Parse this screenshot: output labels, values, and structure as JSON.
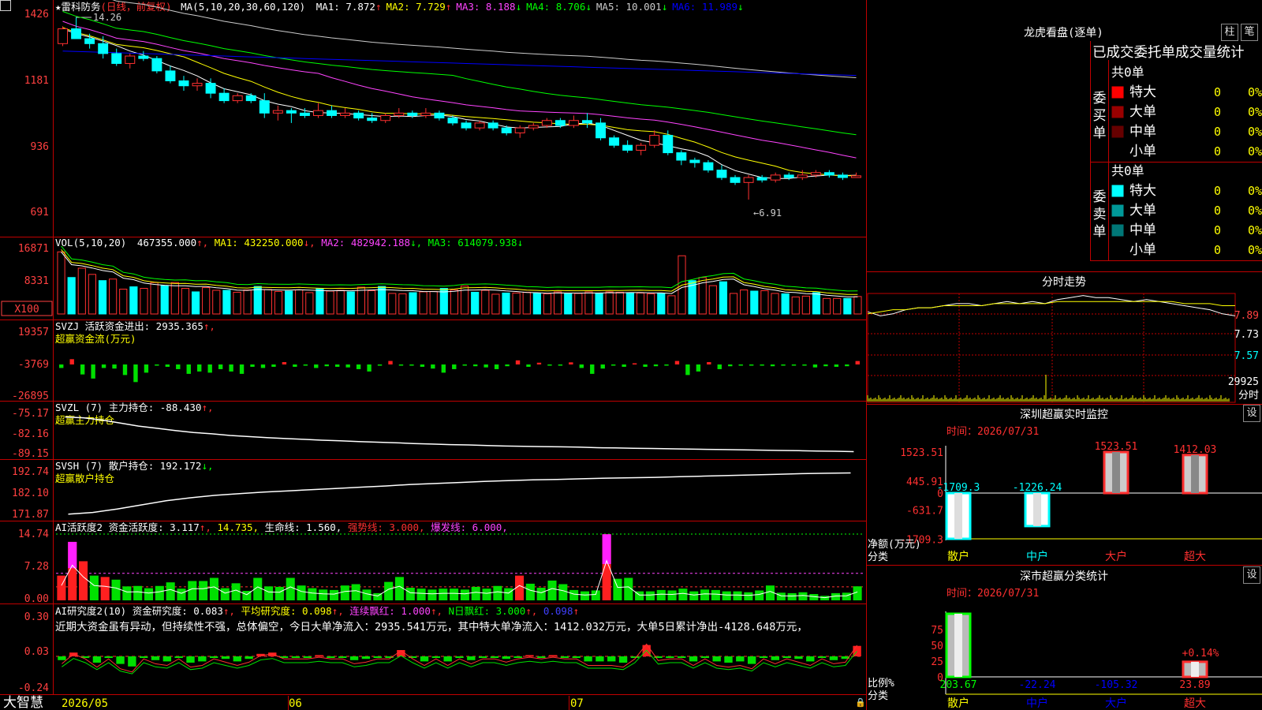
{
  "stock": {
    "name": "★雷科防务",
    "mode": "(日线，前复权)",
    "ma_caption": "MA(5,10,20,30,60,120)",
    "ma_values": [
      {
        "label": "MA1: 7.872",
        "arrow": "↑",
        "color": "#ffffff"
      },
      {
        "label": "MA2: 7.729",
        "arrow": "↑",
        "color": "#ffff00"
      },
      {
        "label": "MA3: 8.188",
        "arrow": "↓",
        "color": "#ff44ff"
      },
      {
        "label": "MA4: 8.706",
        "arrow": "↓",
        "color": "#00ff00"
      },
      {
        "label": "MA5: 10.001",
        "arrow": "↓",
        "color": "#cccccc"
      },
      {
        "label": "MA6: 11.989",
        "arrow": "↓",
        "color": "#0000ff"
      }
    ],
    "high_mark": "14.26",
    "low_mark": "←6.91"
  },
  "vol": {
    "caption": "VOL(5,10,20)",
    "value": "467355.000",
    "ma1": "MA1: 432250.000",
    "ma2": "MA2: 482942.188",
    "ma3": "MA3: 614079.938",
    "unit_label": "X100"
  },
  "svzj": {
    "caption": "SVZJ 活跃资金进出: 2935.365",
    "sub": "超赢资金流(万元)"
  },
  "svzl": {
    "caption": "SVZL (7) 主力持仓: -88.430",
    "sub": "超赢主力持仓"
  },
  "svsh": {
    "caption": "SVSH (7) 散户持仓: 192.172",
    "sub": "超赢散户持仓"
  },
  "ai_active": {
    "caption": "AI活跃度2 资金活跃度: 3.117",
    "v2": "14.735,",
    "v3": "生命线: 1.560,",
    "v4": "强势线: 3.000,",
    "v5": "爆发线: 6.000,"
  },
  "ai_research": {
    "caption": "AI研究度2(10) 资金研究度: 0.083",
    "v2": "平均研究度: 0.098",
    "v3": "连续飘红: 1.000",
    "v4": "N日飘红: 3.000",
    "v5": "0.098",
    "comment": "近期大资金虽有异动，但持续性不强，总体偏空，今日大单净流入：2935.541万元，其中特大单净流入：1412.032万元，大单5日累计净出-4128.648万元，"
  },
  "yaxis": {
    "price": [
      "1426",
      "1181",
      "936",
      "691"
    ],
    "vol": [
      "16871",
      "8331"
    ],
    "svzj": [
      "19357",
      "-3769",
      "-26895"
    ],
    "svzl": [
      "-75.17",
      "-82.16",
      "-89.15"
    ],
    "svsh": [
      "192.74",
      "182.10",
      "171.87"
    ],
    "ai_active": [
      "14.74",
      "7.28",
      "0.00"
    ],
    "ai_research": [
      "0.30",
      "0.03",
      "-0.24"
    ]
  },
  "xaxis": {
    "labels": [
      "2026/05",
      "06",
      "07"
    ],
    "brand": "大智慧"
  },
  "right_panel": {
    "longhu_title": "龙虎看盘(逐单)",
    "btn_zhu": "柱",
    "btn_bi": "笔",
    "stats_title": "已成交委托单成交量统计",
    "buy_label": "委买单",
    "sell_label": "委卖单",
    "buy_total": "共0单",
    "sell_total": "共0单",
    "buy_rows": [
      {
        "name": "特大",
        "count": "0",
        "pct": "0%",
        "color": "#ff0000"
      },
      {
        "name": "大单",
        "count": "0",
        "pct": "0%",
        "color": "#990000"
      },
      {
        "name": "中单",
        "count": "0",
        "pct": "0%",
        "color": "#660000"
      },
      {
        "name": "小单",
        "count": "0",
        "pct": "0%",
        "color": "#000000"
      }
    ],
    "sell_rows": [
      {
        "name": "特大",
        "count": "0",
        "pct": "0%",
        "color": "#00ffff"
      },
      {
        "name": "大单",
        "count": "0",
        "pct": "0%",
        "color": "#009999"
      },
      {
        "name": "中单",
        "count": "0",
        "pct": "0%",
        "color": "#007777"
      },
      {
        "name": "小单",
        "count": "0",
        "pct": "0%",
        "color": "#000000"
      }
    ],
    "intraday_title": "分时走势",
    "intraday_y": [
      "7.89",
      "7.73",
      "7.57"
    ],
    "intraday_vol": "29925",
    "intraday_vol_unit": "分时",
    "monitor_title": "深圳超赢实时监控",
    "monitor_set": "设",
    "monitor_time": "时间：2026/07/31",
    "monitor_y": [
      "1523.51",
      "445.91",
      "0",
      "-631.7",
      "-1709.3"
    ],
    "monitor_ylabel": "净额(万元)",
    "monitor_xlabel": "分类",
    "classify_title": "深市超赢分类统计",
    "classify_set": "设",
    "classify_time": "时间：2026/07/31",
    "classify_y": [
      "75",
      "50",
      "25",
      "0"
    ],
    "classify_ylabel": "比例%",
    "classify_xlabel": "分类",
    "classify_note": "+0.14%"
  },
  "chart_data": [
    {
      "type": "candlestick",
      "title": "雷科防务 日线",
      "note": "price axis labels shown x100",
      "ylim": [
        6.91,
        14.26
      ],
      "candles": [
        [
          13.2,
          13.9,
          13.1,
          13.8
        ],
        [
          13.8,
          14.26,
          13.5,
          13.4
        ],
        [
          13.4,
          13.6,
          13.0,
          13.2
        ],
        [
          13.2,
          13.5,
          12.6,
          12.8
        ],
        [
          12.8,
          13.0,
          12.3,
          12.4
        ],
        [
          12.4,
          12.8,
          12.2,
          12.7
        ],
        [
          12.7,
          12.9,
          12.5,
          12.6
        ],
        [
          12.6,
          12.7,
          12.0,
          12.1
        ],
        [
          12.1,
          12.3,
          11.6,
          11.7
        ],
        [
          11.7,
          11.9,
          11.3,
          11.5
        ],
        [
          11.5,
          11.8,
          11.3,
          11.6
        ],
        [
          11.6,
          11.8,
          11.0,
          11.2
        ],
        [
          11.2,
          11.4,
          10.8,
          10.9
        ],
        [
          10.9,
          11.2,
          10.8,
          11.1
        ],
        [
          11.1,
          11.2,
          10.8,
          10.9
        ],
        [
          10.9,
          11.2,
          10.2,
          10.4
        ],
        [
          10.4,
          10.7,
          10.1,
          10.5
        ],
        [
          10.5,
          10.6,
          10.0,
          10.4
        ],
        [
          10.4,
          10.6,
          10.2,
          10.3
        ],
        [
          10.3,
          10.8,
          10.2,
          10.5
        ],
        [
          10.5,
          10.7,
          10.2,
          10.3
        ],
        [
          10.3,
          10.6,
          10.2,
          10.4
        ],
        [
          10.4,
          10.5,
          10.1,
          10.2
        ],
        [
          10.2,
          10.4,
          10.0,
          10.1
        ],
        [
          10.1,
          10.4,
          10.0,
          10.3
        ],
        [
          10.3,
          10.6,
          10.2,
          10.4
        ],
        [
          10.4,
          10.5,
          10.2,
          10.3
        ],
        [
          10.3,
          10.6,
          10.2,
          10.4
        ],
        [
          10.4,
          10.5,
          10.1,
          10.2
        ],
        [
          10.2,
          10.3,
          9.9,
          10.0
        ],
        [
          10.0,
          10.1,
          9.7,
          9.8
        ],
        [
          9.8,
          10.1,
          9.7,
          10.0
        ],
        [
          10.0,
          10.1,
          9.7,
          9.8
        ],
        [
          9.8,
          9.9,
          9.5,
          9.6
        ],
        [
          9.6,
          9.9,
          9.4,
          9.8
        ],
        [
          9.8,
          10.0,
          9.7,
          9.9
        ],
        [
          9.9,
          10.2,
          9.8,
          10.1
        ],
        [
          10.1,
          10.2,
          9.8,
          9.9
        ],
        [
          9.9,
          10.3,
          9.8,
          10.1
        ],
        [
          10.1,
          10.4,
          9.8,
          10.0
        ],
        [
          10.0,
          10.2,
          9.3,
          9.4
        ],
        [
          9.4,
          9.5,
          9.0,
          9.1
        ],
        [
          9.1,
          9.3,
          8.8,
          8.9
        ],
        [
          8.9,
          9.2,
          8.7,
          9.1
        ],
        [
          9.1,
          9.7,
          9.0,
          9.5
        ],
        [
          9.5,
          9.7,
          8.7,
          8.8
        ],
        [
          8.8,
          8.9,
          8.3,
          8.5
        ],
        [
          8.5,
          8.6,
          8.2,
          8.4
        ],
        [
          8.4,
          8.5,
          8.0,
          8.1
        ],
        [
          8.1,
          8.3,
          7.7,
          7.8
        ],
        [
          7.8,
          7.9,
          7.5,
          7.6
        ],
        [
          7.6,
          7.9,
          6.91,
          7.8
        ],
        [
          7.8,
          7.9,
          7.6,
          7.7
        ],
        [
          7.7,
          8.0,
          7.6,
          7.9
        ],
        [
          7.9,
          8.0,
          7.7,
          7.8
        ],
        [
          7.8,
          8.1,
          7.7,
          7.9
        ],
        [
          7.9,
          8.1,
          7.8,
          8.0
        ],
        [
          8.0,
          8.1,
          7.8,
          7.9
        ],
        [
          7.9,
          8.0,
          7.7,
          7.8
        ],
        [
          7.8,
          8.0,
          7.8,
          7.87
        ]
      ],
      "ma_lines": [
        "MA5",
        "MA10",
        "MA20",
        "MA30",
        "MA60",
        "MA120"
      ]
    },
    {
      "type": "bar",
      "title": "VOL",
      "unit": "X100",
      "ylim": [
        0,
        16871
      ],
      "values": [
        16000,
        9400,
        11800,
        10200,
        8600,
        9000,
        6400,
        7000,
        6600,
        8100,
        7300,
        8100,
        6600,
        5700,
        6800,
        6100,
        6100,
        5600,
        6200,
        7100,
        6300,
        5800,
        5900,
        6200,
        5500,
        6500,
        5900,
        6100,
        5700,
        6900,
        6000,
        7100,
        5300,
        5200,
        5500,
        5700,
        5800,
        6600,
        6200,
        7200,
        5600,
        6100,
        5100,
        5400,
        5400,
        5600,
        5300,
        5200,
        5700,
        5200,
        5300,
        5700,
        5300,
        5700,
        5600,
        5400,
        5400,
        5200,
        5300,
        4700,
        15000,
        8600,
        9400,
        7300,
        8300,
        5300,
        6200,
        5900,
        6000,
        5300,
        5200,
        4400,
        4600,
        5500,
        4000,
        4000,
        4000,
        4500
      ]
    },
    {
      "type": "bar",
      "title": "SVZJ 活跃资金进出",
      "ylim": [
        -26895,
        19357
      ],
      "values": [
        -3000,
        4500,
        -8500,
        -12000,
        -3000,
        -3500,
        -9000,
        -15000,
        -7000,
        -1000,
        -2000,
        -4000,
        -8000,
        -6000,
        -7000,
        -4000,
        -6000,
        -8000,
        -2000,
        -3000,
        -2000,
        2000,
        -2000,
        -1000,
        -3000,
        -1500,
        -2000,
        -2500,
        -4000,
        -6000,
        -1000,
        3000,
        -1000,
        -500,
        -2000,
        -3500,
        -7000,
        -4000,
        -1000,
        -1500,
        -2500,
        -4000,
        -1500,
        3500,
        -2000,
        1500,
        -1000,
        -1000,
        1800,
        -3000,
        -8000,
        -3500,
        -1000,
        -2000,
        1000,
        -2000,
        -1500,
        -1000,
        3000,
        -9000,
        -6000,
        2000,
        -4000,
        -1500,
        -1000,
        -500,
        -1000,
        -1500,
        -1000,
        -1000,
        -1000,
        -2500,
        -1500,
        -2000,
        -1500,
        2935
      ]
    },
    {
      "type": "line",
      "title": "SVZL 主力持仓",
      "ylim": [
        -89.15,
        -75.17
      ],
      "values": [
        -75.9,
        -76.2,
        -77.0,
        -78.1,
        -79.2,
        -80.0,
        -80.8,
        -81.5,
        -82.0,
        -82.6,
        -83.0,
        -83.4,
        -83.7,
        -84.0,
        -84.3,
        -84.5,
        -84.8,
        -85.0,
        -85.2,
        -85.5,
        -85.7,
        -85.9,
        -86.0,
        -86.2,
        -86.4,
        -86.5,
        -86.6,
        -86.7,
        -86.8,
        -87.0,
        -87.1,
        -87.2,
        -87.3,
        -87.4,
        -87.5,
        -87.6,
        -87.7,
        -87.8,
        -87.9,
        -88.0,
        -88.1,
        -88.2,
        -88.3,
        -88.43
      ]
    },
    {
      "type": "line",
      "title": "SVSH 散户持仓",
      "ylim": [
        171.87,
        192.74
      ],
      "values": [
        172.0,
        172.8,
        174.5,
        176.5,
        178.5,
        180.0,
        181.2,
        182.0,
        182.8,
        183.4,
        184.0,
        184.6,
        185.2,
        185.8,
        186.5,
        187.0,
        187.5,
        188.0,
        188.4,
        188.8,
        189.0,
        189.3,
        189.6,
        189.8,
        190.0,
        190.3,
        190.6,
        190.9,
        191.2,
        191.5,
        191.8,
        192.0,
        192.172
      ]
    },
    {
      "type": "bar",
      "title": "AI活跃度2",
      "ylim": [
        0,
        14.74
      ],
      "values": [
        5.5,
        13.0,
        8.7,
        5.5,
        5.2,
        4.6,
        3.1,
        3.2,
        2.7,
        3.2,
        4.0,
        2.6,
        4.3,
        4.3,
        5.0,
        2.7,
        3.8,
        2.1,
        5.0,
        3.1,
        3.0,
        5.0,
        3.3,
        2.7,
        2.4,
        2.3,
        3.3,
        3.6,
        2.4,
        1.6,
        4.1,
        5.2,
        2.8,
        2.6,
        2.4,
        2.6,
        2.6,
        2.4,
        3.0,
        2.6,
        3.2,
        2.7,
        5.5,
        3.7,
        2.8,
        4.4,
        3.6,
        2.3,
        2.0,
        2.2,
        14.7,
        4.8,
        5.0,
        2.0,
        2.0,
        2.3,
        2.2,
        2.6,
        2.0,
        2.4,
        2.3,
        2.0,
        2.0,
        1.8,
        2.2,
        3.3,
        1.7,
        1.6,
        1.8,
        1.4,
        1.0,
        1.6,
        1.7,
        3.117
      ],
      "lines": {
        "强势线": 3.0,
        "爆发线": 6.0,
        "生命线": 1.56
      }
    },
    {
      "type": "bar",
      "title": "AI研究度2(10)",
      "ylim": [
        -0.24,
        0.3
      ],
      "values": [
        -0.03,
        0.03,
        0.0,
        -0.05,
        0.0,
        -0.06,
        -0.08,
        0.0,
        -0.03,
        -0.04,
        0.0,
        -0.05,
        -0.04,
        0.0,
        -0.02,
        -0.04,
        -0.02,
        0.02,
        0.03,
        0.0,
        0.0,
        0.0,
        0.01,
        0.0,
        0.0,
        -0.03,
        -0.02,
        0.0,
        0.0,
        0.05,
        0.0,
        -0.04,
        0.0,
        -0.04,
        0.0,
        -0.03,
        0.0,
        0.0,
        -0.02,
        0.0,
        0.01,
        0.0,
        0.01,
        0.0,
        0.0,
        -0.04,
        -0.04,
        -0.04,
        -0.05,
        0.0,
        0.09,
        -0.01,
        0.0,
        0.0,
        -0.04,
        0.0,
        -0.04,
        -0.05,
        -0.04,
        -0.06,
        0.0,
        -0.03,
        0.0,
        -0.02,
        -0.04,
        0.0,
        -0.03,
        -0.02,
        0.083
      ]
    },
    {
      "type": "bar",
      "title": "深圳超赢实时监控",
      "categories": [
        "散户",
        "中户",
        "大户",
        "超大"
      ],
      "values": [
        -1709.3,
        -1226.24,
        1523.51,
        1412.03
      ],
      "ylim": [
        -1709.3,
        1523.51
      ]
    },
    {
      "type": "bar",
      "title": "深市超赢分类统计",
      "categories": [
        "散户",
        "中户",
        "大户",
        "超大"
      ],
      "values": [
        203.67,
        -22.24,
        -105.32,
        23.89
      ],
      "ylim": [
        0,
        100
      ]
    },
    {
      "type": "line",
      "title": "分时走势",
      "ylim": [
        7.57,
        7.95
      ],
      "values": [
        7.86,
        7.84,
        7.85,
        7.87,
        7.88,
        7.88,
        7.89,
        7.9,
        7.9,
        7.89,
        7.9,
        7.91,
        7.9,
        7.91,
        7.9,
        7.92,
        7.93,
        7.94,
        7.93,
        7.93,
        7.92,
        7.91,
        7.92,
        7.91,
        7.9,
        7.89,
        7.88,
        7.87,
        7.85,
        7.84
      ],
      "avg": [
        7.85,
        7.86,
        7.87,
        7.87,
        7.88,
        7.88,
        7.89,
        7.89,
        7.89,
        7.89,
        7.9,
        7.9,
        7.9,
        7.9,
        7.9,
        7.91,
        7.91,
        7.91,
        7.91,
        7.91,
        7.91,
        7.91,
        7.91,
        7.91,
        7.91,
        7.9,
        7.9,
        7.9,
        7.89,
        7.89
      ]
    }
  ]
}
